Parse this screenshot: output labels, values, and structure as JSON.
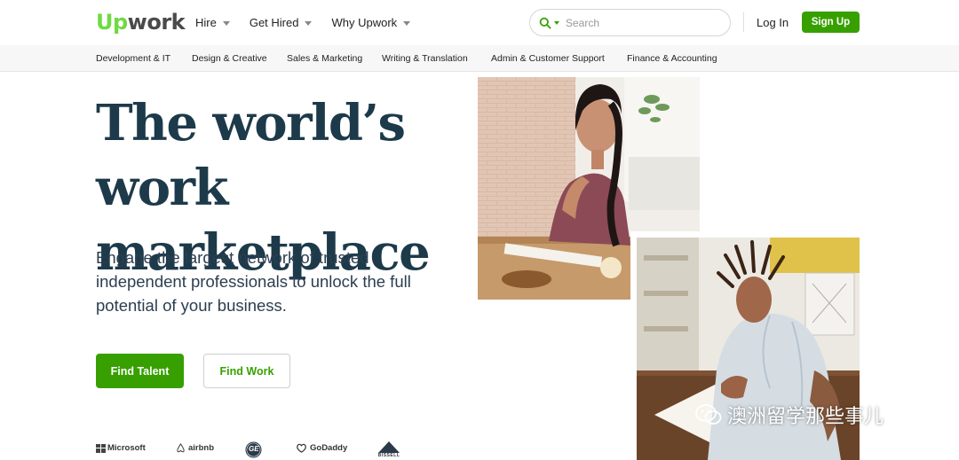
{
  "header": {
    "logo_up": "Up",
    "logo_work": "work",
    "nav": [
      {
        "label": "Hire"
      },
      {
        "label": "Get Hired"
      },
      {
        "label": "Why Upwork"
      }
    ],
    "search_placeholder": "Search",
    "login_label": "Log In",
    "signup_label": "Sign Up"
  },
  "categories": [
    "Development & IT",
    "Design & Creative",
    "Sales & Marketing",
    "Writing & Translation",
    "Admin & Customer Support",
    "Finance & Accounting"
  ],
  "hero": {
    "title_line1": "The world’s work",
    "title_line2": "marketplace",
    "subtitle": "Engage the largest network of trusted independent professionals to unlock the full potential of your business.",
    "find_talent_label": "Find Talent",
    "find_work_label": "Find Work"
  },
  "brands": {
    "microsoft": "Microsoft",
    "airbnb": "airbnb",
    "ge": "GE",
    "godaddy": "GoDaddy",
    "bissell": "BISSELL"
  },
  "watermark": "澳洲留学那些事儿",
  "colors": {
    "brand_green": "#37a000",
    "logo_green": "#6fda44",
    "title_navy": "#1d3a4a"
  },
  "icons": {
    "search": "search-icon",
    "caret": "chevron-down-icon"
  }
}
